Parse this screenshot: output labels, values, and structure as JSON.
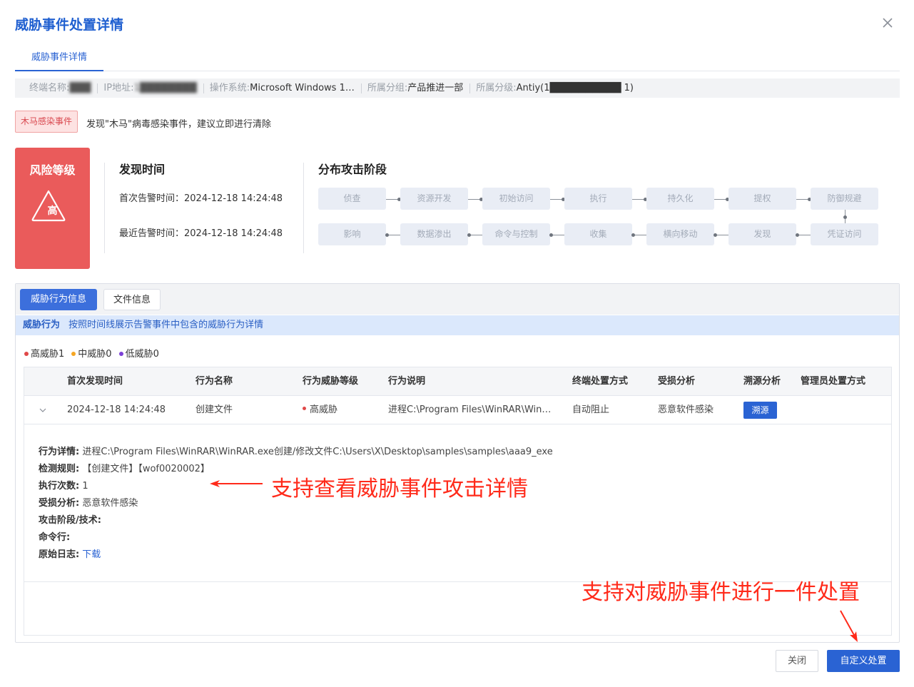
{
  "dialog": {
    "title": "威胁事件处置详情"
  },
  "tabs": [
    {
      "label": "威胁事件详情"
    }
  ],
  "info": {
    "hostname_label": "终端名称:",
    "hostname_value": "███",
    "ip_label": "IP地址:",
    "ip_value": "1████████",
    "os_label": "操作系统:",
    "os_value": "Microsoft Windows 1…",
    "group_label": "所属分组:",
    "group_value": "产品推进一部",
    "level_label": "所属分级:",
    "level_value": "Antiy(1██████████ 1)"
  },
  "event": {
    "tag": "木马感染事件",
    "desc": "发现\"木马\"病毒感染事件，建议立即进行清除"
  },
  "risk": {
    "title": "风险等级",
    "level": "高",
    "color": "#ea5b5b"
  },
  "discovery": {
    "title": "发现时间",
    "first": "首次告警时间：2024-12-18 14:24:48",
    "last": "最近告警时间：2024-12-18 14:24:48"
  },
  "stages": {
    "title": "分布攻击阶段",
    "row1": [
      "侦查",
      "资源开发",
      "初始访问",
      "执行",
      "持久化",
      "提权",
      "防御规避"
    ],
    "row2": [
      "影响",
      "数据渗出",
      "命令与控制",
      "收集",
      "横向移动",
      "发现",
      "凭证访问"
    ]
  },
  "panel": {
    "tab_behavior": "威胁行为信息",
    "tab_file": "文件信息",
    "hint_strong": "威胁行为",
    "hint_text": "按照时间线展示告警事件中包含的威胁行为详情",
    "legend": {
      "high": "高威胁1",
      "mid": "中威胁0",
      "low": "低威胁0"
    },
    "colors": {
      "high": "#e04848",
      "mid": "#f5a623",
      "low": "#7b3fd6"
    }
  },
  "table": {
    "headers": [
      "首次发现时间",
      "行为名称",
      "行为威胁等级",
      "行为说明",
      "终端处置方式",
      "受损分析",
      "溯源分析",
      "管理员处置方式"
    ],
    "row": {
      "time": "2024-12-18 14:24:48",
      "name": "创建文件",
      "severity": "高威胁",
      "desc": "进程C:\\Program Files\\WinRAR\\Win…",
      "action": "自动阻止",
      "damage": "恶意软件感染",
      "trace_btn": "溯源",
      "admin": ""
    }
  },
  "detail": {
    "behavior_label": "行为详情:",
    "behavior_value": "进程C:\\Program Files\\WinRAR\\WinRAR.exe创建/修改文件C:\\Users\\X\\Desktop\\samples\\samples\\aaa9_exe",
    "rule_label": "检测规则:",
    "rule_value": "【创建文件】【wof0020002】",
    "count_label": "执行次数:",
    "count_value": "1",
    "damage_label": "受损分析:",
    "damage_value": "恶意软件感染",
    "stage_label": "攻击阶段/技术:",
    "cmd_label": "命令行:",
    "log_label": "原始日志:",
    "log_link": "下载"
  },
  "annotations": {
    "view_detail": "支持查看威胁事件攻击详情",
    "one_click": "支持对威胁事件进行一件处置"
  },
  "footer": {
    "close": "关闭",
    "custom": "自定义处置"
  }
}
